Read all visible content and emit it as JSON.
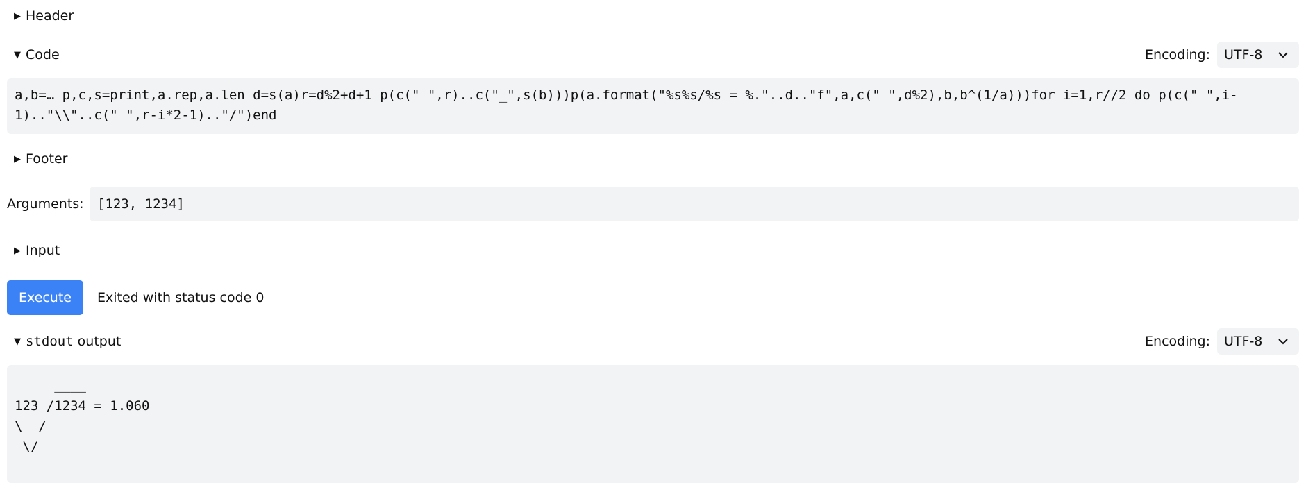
{
  "sections": {
    "header": {
      "label": "Header",
      "expanded": false,
      "icon": "triangle-right-icon"
    },
    "code": {
      "label": "Code",
      "expanded": true,
      "icon": "triangle-down-icon"
    },
    "footer": {
      "label": "Footer",
      "expanded": false,
      "icon": "triangle-right-icon"
    },
    "input": {
      "label": "Input",
      "expanded": false,
      "icon": "triangle-right-icon"
    },
    "stdout": {
      "label_mono": "stdout",
      "label_rest": " output",
      "expanded": true,
      "icon": "triangle-down-icon"
    }
  },
  "glyphs": {
    "collapsed": "▶",
    "expanded": "▼"
  },
  "code_encoding": {
    "label": "Encoding:",
    "value": "UTF-8"
  },
  "stdout_encoding": {
    "label": "Encoding:",
    "value": "UTF-8"
  },
  "code": "a,b=… p,c,s=print,a.rep,a.len d=s(a)r=d%2+d+1 p(c(\" \",r)..c(\"_\",s(b)))p(a.format(\"%s%s/%s = %.\"..d..\"f\",a,c(\" \",d%2),b,b^(1/a)))for i=1,r//2 do p(c(\" \",i-1)..\"\\\\\"..c(\" \",r-i*2-1)..\"/\")end",
  "arguments": {
    "label": "Arguments:",
    "value": "[123, 1234]"
  },
  "execute": {
    "label": "Execute",
    "color": "#3b82f6"
  },
  "status": "Exited with status code 0",
  "stdout": "     ____\n123 /1234 = 1.060\n\\  /\n \\/"
}
